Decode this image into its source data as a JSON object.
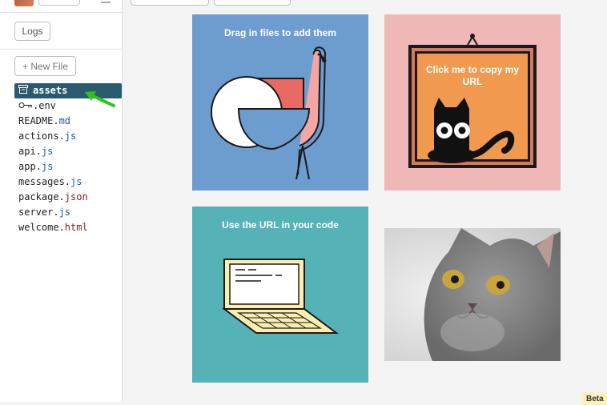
{
  "sidebar": {
    "logs_label": "Logs",
    "new_file_label": "+ New File",
    "files": [
      {
        "name": "assets",
        "ext": ""
      },
      {
        "name": ".env",
        "ext": ""
      },
      {
        "name": "README.",
        "ext": "md"
      },
      {
        "name": "actions.",
        "ext": "js"
      },
      {
        "name": "api.",
        "ext": "js"
      },
      {
        "name": "app.",
        "ext": "js"
      },
      {
        "name": "messages.",
        "ext": "js"
      },
      {
        "name": "package.",
        "ext": "json"
      },
      {
        "name": "server.",
        "ext": "js"
      },
      {
        "name": "welcome.",
        "ext": "html"
      }
    ],
    "active_file": "assets"
  },
  "tiles": {
    "drag": {
      "title": "Drag in files to add them",
      "color": "#6d9ccf"
    },
    "copy": {
      "title": "Click me to copy my URL",
      "color": "#f0b7b7"
    },
    "use": {
      "title": "Use the URL in your code",
      "color": "#55b3b7"
    }
  },
  "badge": {
    "label": "Beta"
  }
}
